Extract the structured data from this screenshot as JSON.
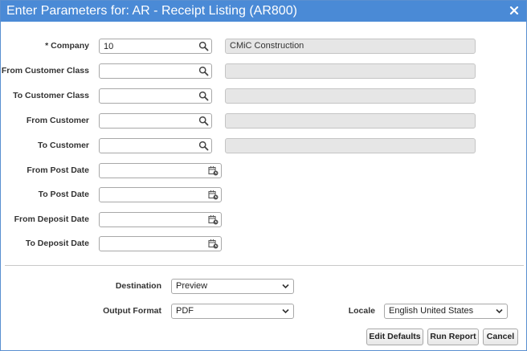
{
  "dialog": {
    "title": "Enter Parameters for: AR - Receipt Listing (AR800)",
    "close_icon": "close-icon"
  },
  "fields": {
    "company": {
      "label": "* Company",
      "value": "10",
      "description": "CMiC Construction"
    },
    "from_customer_class": {
      "label": "From Customer Class",
      "value": "",
      "description": ""
    },
    "to_customer_class": {
      "label": "To Customer Class",
      "value": "",
      "description": ""
    },
    "from_customer": {
      "label": "From Customer",
      "value": "",
      "description": ""
    },
    "to_customer": {
      "label": "To Customer",
      "value": "",
      "description": ""
    },
    "from_post_date": {
      "label": "From Post Date",
      "value": ""
    },
    "to_post_date": {
      "label": "To Post Date",
      "value": ""
    },
    "from_deposit_date": {
      "label": "From Deposit Date",
      "value": ""
    },
    "to_deposit_date": {
      "label": "To Deposit Date",
      "value": ""
    }
  },
  "output": {
    "destination": {
      "label": "Destination",
      "selected": "Preview"
    },
    "output_format": {
      "label": "Output Format",
      "selected": "PDF"
    },
    "locale": {
      "label": "Locale",
      "selected": "English United States"
    }
  },
  "buttons": {
    "edit_defaults": "Edit Defaults",
    "run_report": "Run Report",
    "cancel": "Cancel"
  },
  "icons": {
    "lookup": "search-icon",
    "date": "calendar-icon",
    "dropdown": "chevron-down-icon"
  },
  "colors": {
    "titlebar": "#4a8ad6",
    "readonly_bg": "#e6e6e6"
  }
}
